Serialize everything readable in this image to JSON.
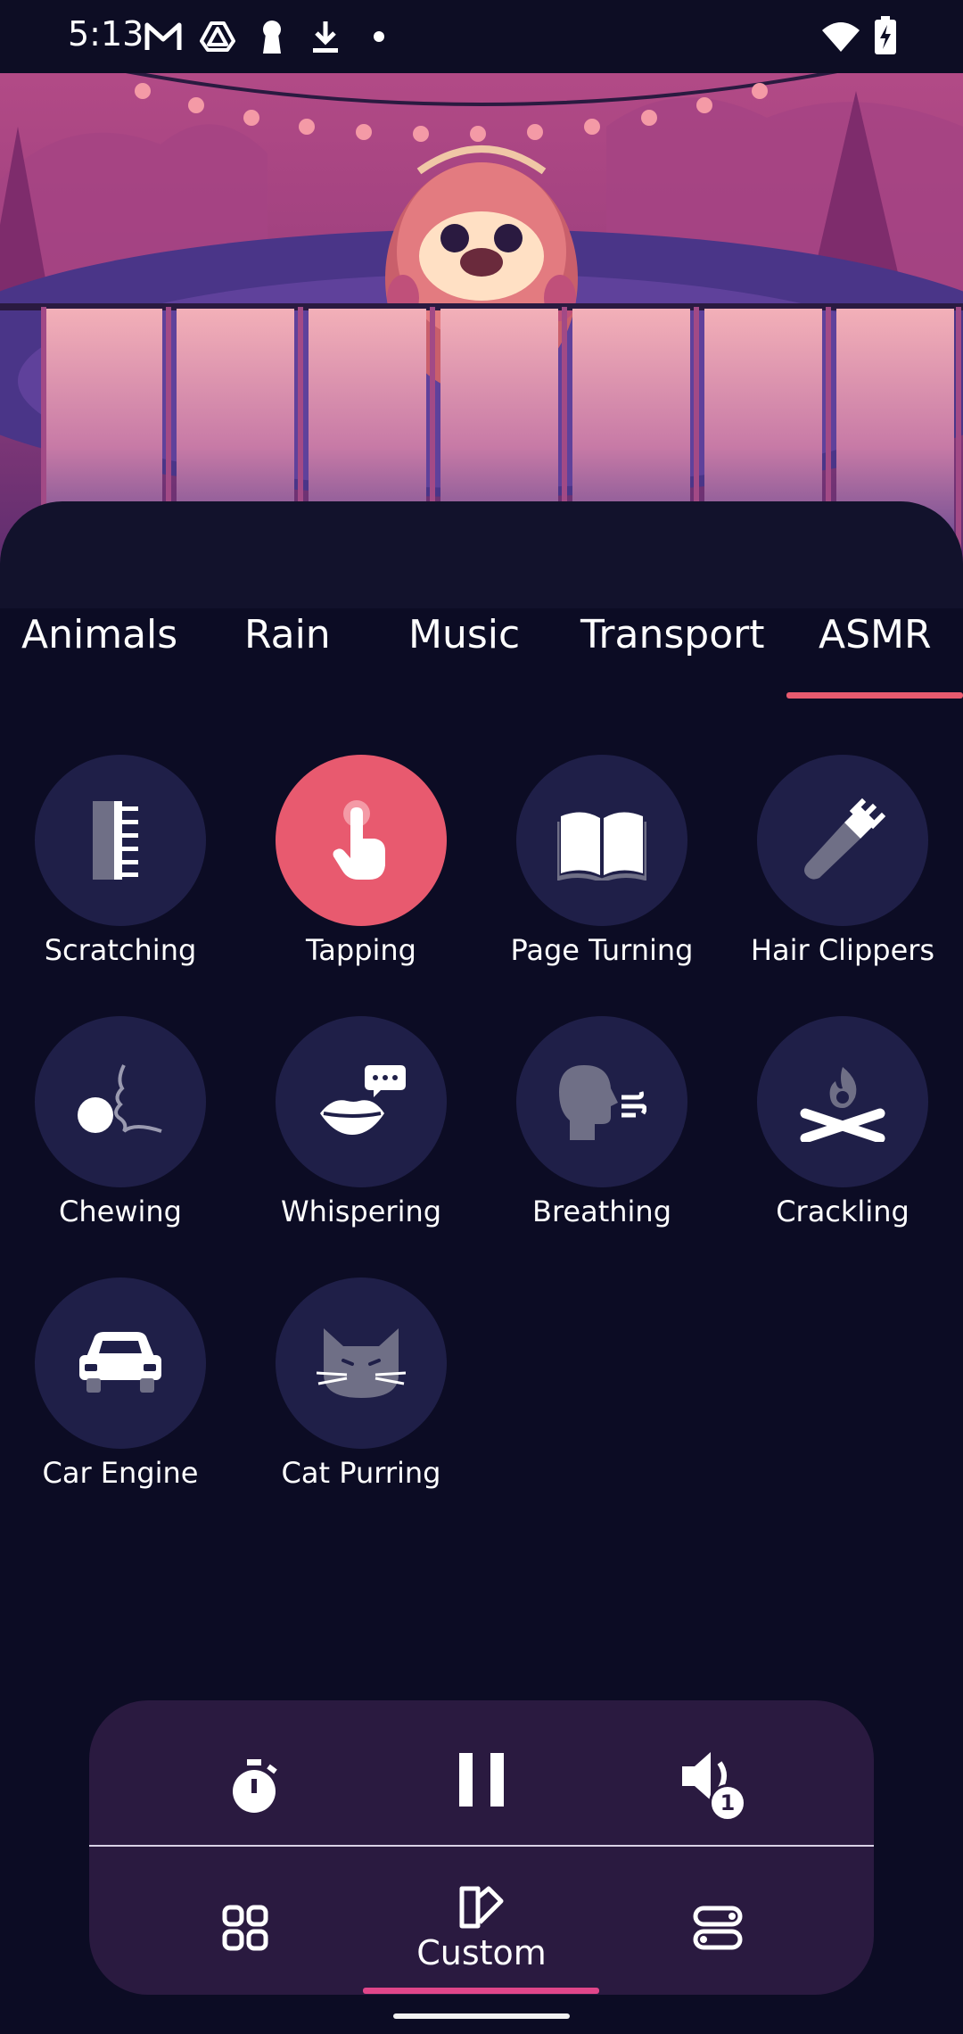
{
  "status_bar": {
    "time": "5:13",
    "left_icons": [
      "gmail-icon",
      "drive-icon",
      "keyhole-icon",
      "download-icon",
      "dot-icon"
    ],
    "right_icons": [
      "wifi-icon",
      "battery-charging-icon"
    ]
  },
  "tabs": {
    "items": [
      "Animals",
      "Rain",
      "Music",
      "Transport",
      "ASMR"
    ],
    "selected": "ASMR"
  },
  "sounds": [
    {
      "label": "Scratching",
      "icon": "comb-icon",
      "active": false
    },
    {
      "label": "Tapping",
      "icon": "finger-tap-icon",
      "active": true
    },
    {
      "label": "Page Turning",
      "icon": "open-book-icon",
      "active": false
    },
    {
      "label": "Hair Clippers",
      "icon": "hair-clippers-icon",
      "active": false
    },
    {
      "label": "Chewing",
      "icon": "chewing-face-icon",
      "active": false
    },
    {
      "label": "Whispering",
      "icon": "lips-speech-icon",
      "active": false
    },
    {
      "label": "Breathing",
      "icon": "head-breath-icon",
      "active": false
    },
    {
      "label": "Crackling",
      "icon": "campfire-icon",
      "active": false
    },
    {
      "label": "Car Engine",
      "icon": "car-icon",
      "active": false
    },
    {
      "label": "Cat Purring",
      "icon": "cat-icon",
      "active": false
    }
  ],
  "player": {
    "timer_icon": "stopwatch-icon",
    "pause_icon": "pause-icon",
    "volume_icon": "volume-icon",
    "volume_badge": "1"
  },
  "bottom_nav": {
    "items": [
      {
        "icon": "grid-icon",
        "label": ""
      },
      {
        "icon": "custom-icon",
        "label": "Custom"
      },
      {
        "icon": "toggles-icon",
        "label": ""
      }
    ],
    "selected": "Custom"
  },
  "colors": {
    "background": "#0c0c24",
    "accent": "#e85a6f",
    "circle": "#1f1f48",
    "player": "#2a1a40"
  }
}
